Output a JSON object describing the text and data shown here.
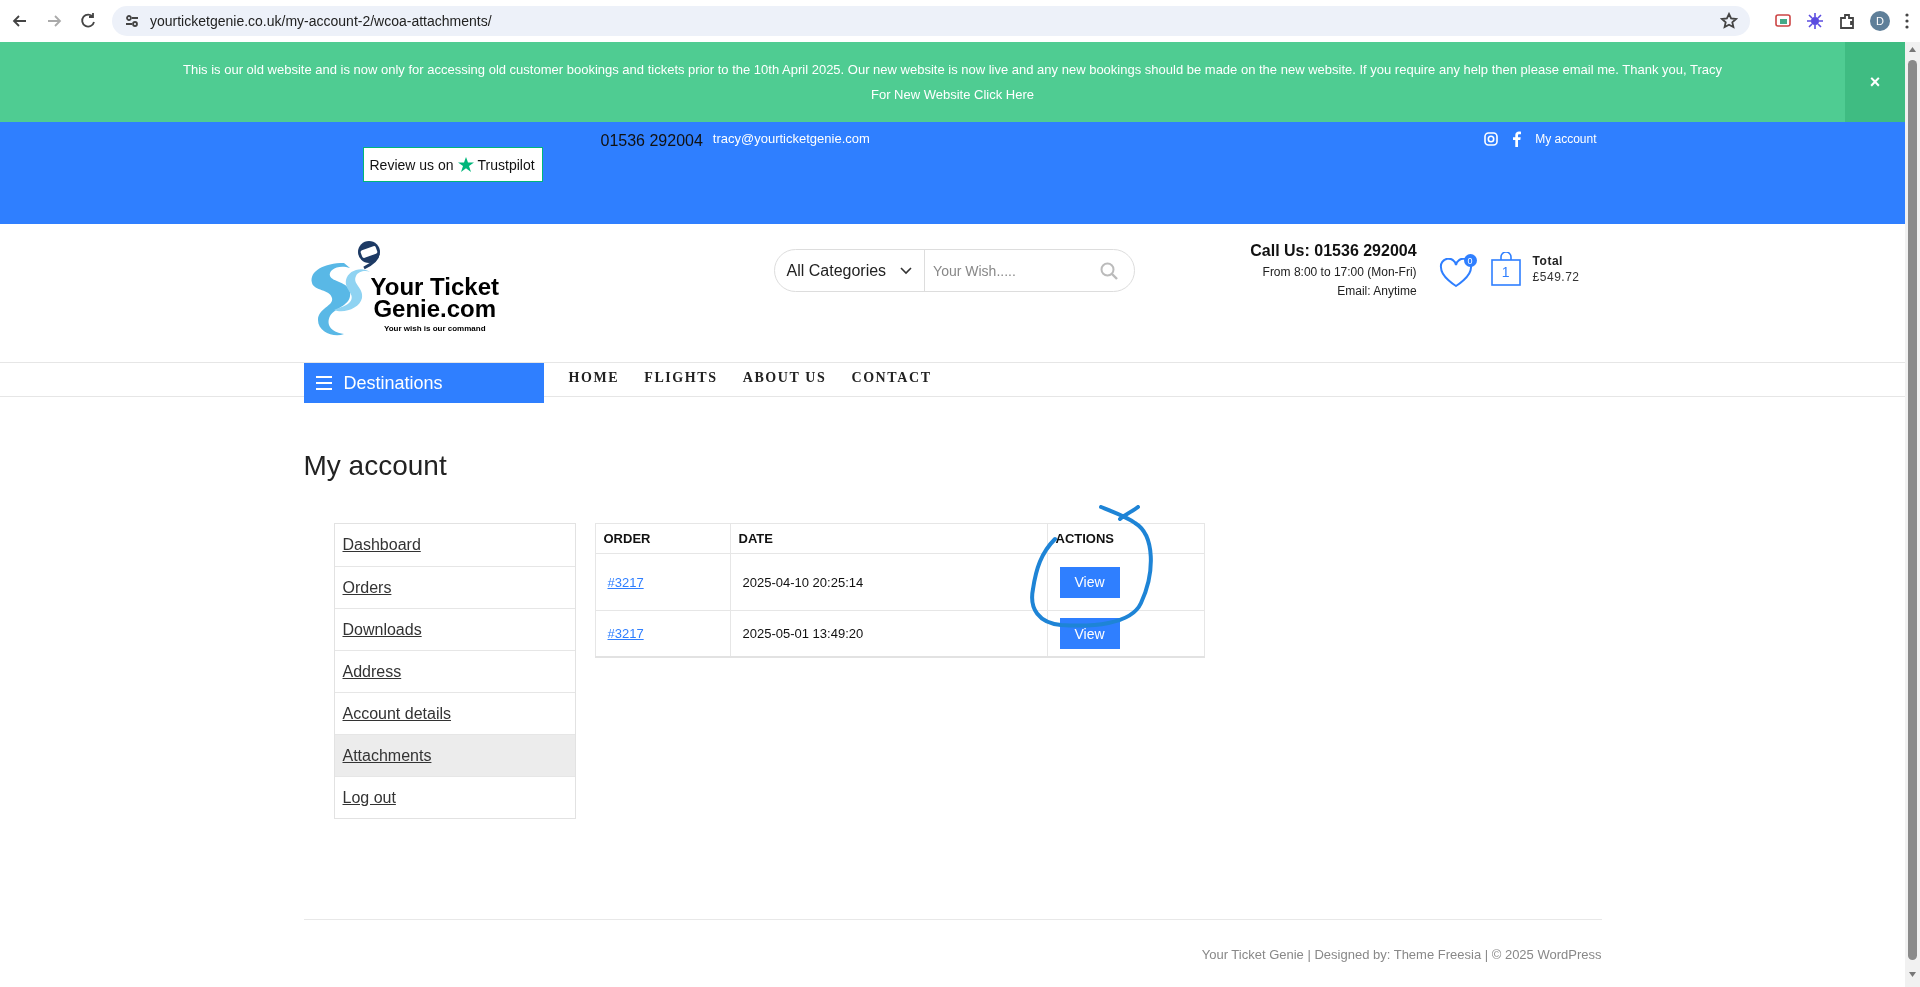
{
  "browser": {
    "url": "yourticketgenie.co.uk/my-account-2/wcoa-attachments/",
    "profile_initial": "D"
  },
  "banner": {
    "message": "This is our old website and is now only for accessing old customer bookings and tickets prior to the 10th April 2025. Our new website is now live and any new bookings should be made on the new website. If you require any help then please email me. Thank you, Tracy",
    "link": "For New Website Click Here",
    "close": "×"
  },
  "topbar": {
    "trustpilot": {
      "prefix": "Review us on",
      "brand": "Trustpilot"
    },
    "phone": "01536 292004",
    "email": "tracy@yourticketgenie.com",
    "my_account": "My account"
  },
  "header": {
    "logo": {
      "line1": "Your Ticket",
      "line2": "Genie.com",
      "tagline": "Your wish is our command"
    },
    "search": {
      "category": "All Categories",
      "placeholder": "Your Wish....."
    },
    "contact": {
      "call": "Call Us: 01536 292004",
      "hours": "From 8:00 to 17:00 (Mon-Fri)",
      "email": "Email: Anytime"
    },
    "wishlist_count": "0",
    "cart": {
      "count": "1",
      "total_label": "Total",
      "total": "£549.72"
    }
  },
  "nav": {
    "destinations": "Destinations",
    "links": [
      "HOME",
      "FLIGHTS",
      "ABOUT US",
      "CONTACT"
    ]
  },
  "page": {
    "title": "My account"
  },
  "account_menu": [
    {
      "label": "Dashboard",
      "selected": false
    },
    {
      "label": "Orders",
      "selected": false
    },
    {
      "label": "Downloads",
      "selected": false
    },
    {
      "label": "Address",
      "selected": false
    },
    {
      "label": "Account details",
      "selected": false
    },
    {
      "label": "Attachments",
      "selected": true
    },
    {
      "label": "Log out",
      "selected": false
    }
  ],
  "orders_table": {
    "columns": [
      "ORDER",
      "DATE",
      "ACTIONS"
    ],
    "rows": [
      {
        "order": "#3217",
        "date": "2025-04-10 20:25:14",
        "action": "View"
      },
      {
        "order": "#3217",
        "date": "2025-05-01 13:49:20",
        "action": "View"
      }
    ]
  },
  "footer": {
    "credits": "Your Ticket Genie | Designed by: Theme Freesia | © 2025 WordPress"
  }
}
